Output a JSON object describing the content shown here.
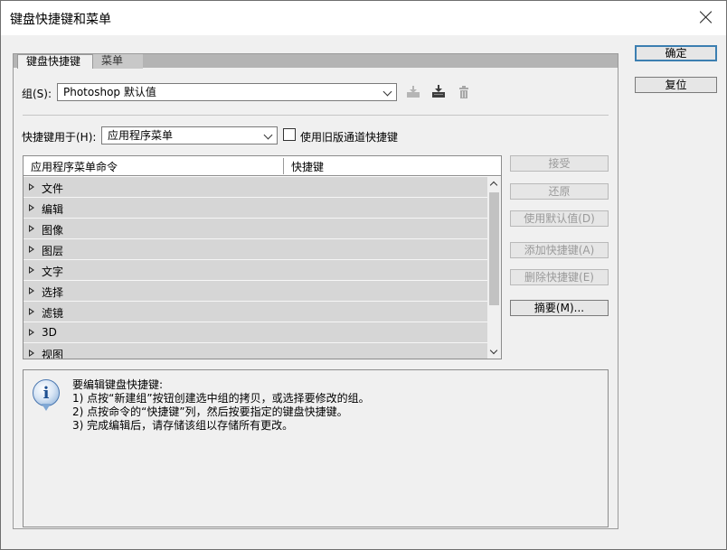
{
  "window": {
    "title": "键盘快捷键和菜单"
  },
  "buttons": {
    "ok": "确定",
    "reset": "复位",
    "accept": "接受",
    "undo": "还原",
    "use_default": "使用默认值(D)",
    "add_shortcut": "添加快捷键(A)",
    "delete_shortcut": "删除快捷键(E)",
    "summarize": "摘要(M)..."
  },
  "tabs": [
    "键盘快捷键",
    "菜单"
  ],
  "set": {
    "label": "组(S):",
    "value": "Photoshop 默认值"
  },
  "shortcuts_for": {
    "label": "快捷键用于(H):",
    "value": "应用程序菜单"
  },
  "legacy_checkbox": {
    "label": "使用旧版通道快捷键",
    "checked": false
  },
  "table": {
    "col_command": "应用程序菜单命令",
    "col_shortcut": "快捷键",
    "rows": [
      "文件",
      "编辑",
      "图像",
      "图层",
      "文字",
      "选择",
      "滤镜",
      "3D",
      "视图"
    ]
  },
  "info": {
    "heading": "要编辑键盘快捷键:",
    "lines": [
      "1) 点按“新建组”按钮创建选中组的拷贝，或选择要修改的组。",
      "2) 点按命令的“快捷键”列，然后按要指定的键盘快捷键。",
      "3) 完成编辑后，请存储该组以存储所有更改。"
    ]
  },
  "icons": [
    "save-set-icon",
    "new-set-icon",
    "delete-set-icon",
    "info-icon",
    "close-icon"
  ]
}
